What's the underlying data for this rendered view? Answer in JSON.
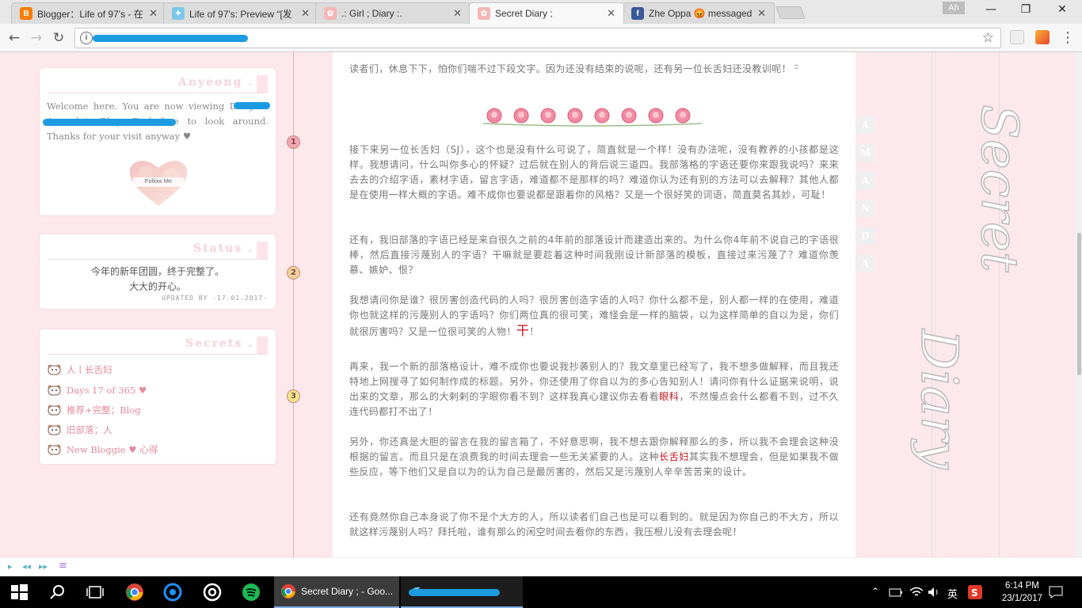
{
  "browser": {
    "tabs": [
      {
        "title": "Blogger：Life of 97's - 在",
        "icon": "blogger-icon"
      },
      {
        "title": "Life of 97's: Preview “[发",
        "icon": "bird-icon"
      },
      {
        "title": ".: Girl ; Diary :.",
        "icon": "flower-icon"
      },
      {
        "title": "Secret Diary ;",
        "icon": "flower-icon"
      },
      {
        "title": "Zhe Oppa 😡 messaged",
        "icon": "facebook-icon"
      }
    ],
    "user_badge": "Ah",
    "window_controls": {
      "minimize": "—",
      "maximize": "❐",
      "close": "✕"
    },
    "nav": {
      "back": "←",
      "forward": "→",
      "reload": "↻"
    },
    "address": "",
    "info_glyph": "i",
    "star_glyph": "☆",
    "tab_close": "✕"
  },
  "sidebar": {
    "anyeong": {
      "title": "Anyeong .",
      "welcome": "Welcome here. You are now viewing                              Diary of Amanda's Blog. Feel free to look around. Thanks for your visit anyway ♥",
      "follow_label": "Follow Me"
    },
    "status": {
      "title": "Status .",
      "line1": "今年的新年团圆，终于完整了。",
      "line2": "大大的开心。",
      "updated": "UPDATED BY -17.01.2017-"
    },
    "secrets": {
      "title": "Secrets .",
      "items": [
        "人丨长舌妇",
        "Days 17 of 365 ♥",
        "推荐+完整；Blog",
        "旧部落；人",
        "New Bloggie ♥ 心得"
      ]
    },
    "badges": [
      "1",
      "2",
      "3"
    ]
  },
  "post": {
    "intro": "读者们，休息下下，怕你们喘不过下段文字。因为还没有结束的说呢，还有另一位长舌妇还没教训呢！ ᵕ̈",
    "p1": "接下来另一位长舌妇（SJ），这个也是没有什么可说了，简直就是一个样！没有办法呢，没有教养的小孩都是这样。我想请问，什么叫你多心的怀疑？过后就在别人的背后说三道四。我部落格的字语还要你来跟我说吗？来来去去的介绍字语，素材字语，留言字语，难道都不是那样的吗？难道你认为还有别的方法可以去解释？其他人都是在使用一样大概的字语。难不成你也要说都是跟着你的风格？又是一个很好笑的词语，简直莫名其妙，可耻！",
    "p2": "还有，我旧部落的字语已经是来自很久之前的4年前的部落设计而建造出来的。为什么你4年前不说自己的字语很棒，然后直接污蔑别人的字语？干嘛就是要趁着这种时间我刚设计新部落的模板，直接过来污蔑了？难道你羡慕、嫉妒、恨？",
    "p3": "我想请问你是谁？很厉害创造代码的人吗？很厉害创造字语的人吗？你什么都不是，别人都一样的在使用，难道你也就这样的污蔑别人的字语吗？你们两位真的很可笑，难怪会是一样的脑袋，以为这样简单的自以为是，你们就很厉害吗？又是一位很可笑的人物！",
    "p3_end": "干",
    "p3_tail": "！",
    "p4a": "再来，我一个新的部落格设计，难不成你也要说我抄袭别人的？我文章里已经写了，我不想多做解释，而且我还特地上网搜寻了如何制作成的标题。另外，你还使用了你自以为的多心告知别人！请问你有什么证据来说明，说出来的文章，那么的大剌剌的字眼你看不到？这样我真心建议你去看看",
    "p4_red": "眼科",
    "p4b": "，不然慢点会什么都看不到，过不久连代码都打不出了！",
    "p5a": "另外，你还真是大胆的留言在我的留言箱了，不好意思啊，我不想去跟你解释那么的多，所以我不会理会这种没根据的留言。而且只是在浪费我的时间去理会一些无关紧要的人。这种",
    "p5_red": "长舌妇",
    "p5b": "其实我不想理会，但是如果我不做些反应，等下他们又是自以为的认为自己是最厉害的，然后又是污蔑别人辛辛苦苦来的设计。",
    "p6": "还有竟然你自己本身说了你不是个大方的人，所以读者们自己也是可以看到的。就是因为你自己的不大方，所以就这样污蔑别人吗？拜托啦，谁有那么的闲空时间去看你的东西，我压根儿没有去理会呢！"
  },
  "right_nav": [
    "A",
    "M",
    "A",
    "N",
    "D",
    "A"
  ],
  "script_title_1": "Secret",
  "script_title_2": "Diary ;",
  "bottom_controls": [
    "▸",
    "◂◂",
    "▸▸",
    "≡"
  ],
  "taskbar": {
    "tasks": [
      {
        "label": "Secret Diary ; - Goo..."
      },
      {
        "label": "                     "
      }
    ],
    "ime": "英",
    "time": "6:14 PM",
    "date": "23/1/2017"
  },
  "colors": {
    "page_bg": "#fde8ec",
    "accent_red": "#c4121a",
    "secret_pink": "#e48b9d",
    "text_grey": "#777777"
  }
}
